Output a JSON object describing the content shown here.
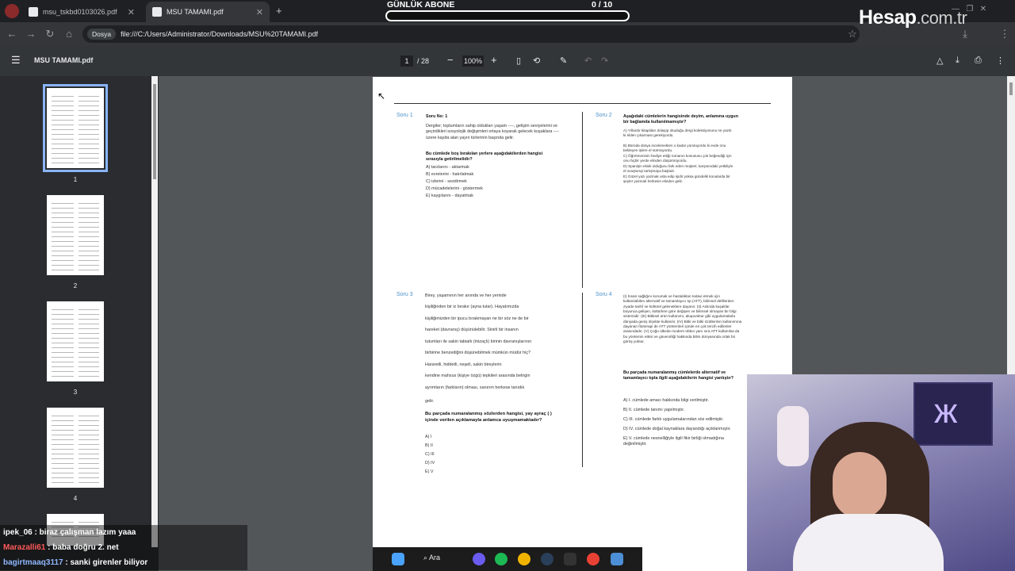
{
  "tabs": [
    {
      "label": "msu_tskbd0103026.pdf",
      "active": false
    },
    {
      "label": "MSU TAMAMI.pdf",
      "active": true
    }
  ],
  "address": {
    "chip": "Dosya",
    "url": "file:///C:/Users/Administrator/Downloads/MSU%20TAMAMI.pdf"
  },
  "pdf_toolbar": {
    "title": "MSU TAMAMI.pdf",
    "page": "1",
    "total": "/ 28",
    "zoom": "100%"
  },
  "thumbnails": [
    "1",
    "2",
    "3",
    "4"
  ],
  "overlay": {
    "label": "GÜNLÜK ABONE",
    "count": "0 / 10",
    "logo": "Hesap",
    "logo_suffix": ".com.tr"
  },
  "pdf_page": {
    "q1": {
      "label": "Soru 1",
      "header": "Soru No: 1",
      "text": "Dergiler; toplumların sahip oldukları yaşam ----, gelişim seviyelerini ve geçirdikleri sosyolojik değişimleri ortaya koyarak gelecek kuşaklara ---- üzere kayda alan yayın türlerinin başında gelir.",
      "question": "Bu cümlede boş bırakılan yerlere aşağıdakilerden hangisi sırasıyla getirilmelidir?",
      "options": [
        "A) tarzlarını - aktarmak",
        "B) evrelerini - hatırlatmak",
        "C) izlerini - sezdirmek",
        "D) mücadelelerini - göstermek",
        "E) kaygılarını - dayatmak"
      ]
    },
    "q2": {
      "label": "Soru 2",
      "question": "Aşağıdaki cümlelerin hangisinde deyim, anlamına uygun bir bağlamda kullanılmamıştır?",
      "options": [
        "A) Yıllardır kitaplıları dolaşıp okuduğu dergi koleksiyonunu ne yazık ki elden çıkarması gerekiyordu.",
        "B) Büroda dosya incelemekten o kadar yoruluyordu ki evde onu bekleyen işlere el sürmüyordu.",
        "C) Öğretmeninin hediye ettiği romanın konusunu çok beğendiği için onu hiçbir yerde elinden düşürmüyordu.",
        "D) Spanişin eksik olduğunu fark eden müşteri, karşısındaki yetkiliyle el ovuşturup tartışmaya başladı.",
        "E) Güzel yazı yazmak usta edip işidir yoksa gündelik konularda bir şeyler yazmak herkesin elinden gelir."
      ]
    },
    "q3": {
      "label": "Soru 3",
      "lines": [
        "Birey, yaşamının her anında ve her yerinde",
        "kişiliğinden bir iz bırakır (ayna tutar). Hayatımızda",
        "kişiliğimizden bir ipucu bırakmayan ne bir söz ne de bir",
        "hareket (davranış) düşünülebilir. Sinirli bir insanın",
        "tutumları ile sakin tabiatlı (mizaçlı) birinin davranışlarının",
        "birbirine benzediğini düşünebilmek mümkün müdür hiç?",
        "Hararetli, hiddetli, neşeli, sakin bireylerin",
        "kendine mahsus (kişiye özgü) tepkileri arasında belirgin",
        "ayrımların (farkların) olması, sanırım herkese tanıdık",
        "gelir."
      ],
      "question": "Bu parçada numaralanmış sözlerden hangisi, yay ayraç ( ) içinde verilen açıklamayla anlamca uyuşmamaktadır?",
      "options": [
        "A) I",
        "B) II",
        "C) III",
        "D) IV",
        "E) V"
      ]
    },
    "q4": {
      "label": "Soru 4",
      "text": "(I) İnsan sağlığını korumak ve hastalıkları tedavi etmek için kullanılabilen alternatif ve tamamlayıcı tıp (ATT), bilimsel delillerden ziyade tarihî ve kültürel geleneklere dayanır. (II) Aslında kuşaklar boyunca gelişen, kültürlere göre değişen ve bilimsel olmayan bir bilgi sistemidir. (III) Bitkisel ürün kullanımı, akupunktur gibi uygulamalarla dünyada geniş ölçekte kullanılır. (IV) Bitki ve bitki özütlerinin kullanımına dayanan fitoterapi de ATT yöntemleri içinde en çok tercih edilenler arasındadır. (V) Çoğu ülkede modern tıbbın yanı sıra ATT kullanılsa da bu yöntemin etkisi ve güvenirliği hakkında bilim dünyasında ortak bir görüş yoktur.",
      "question": "Bu parçada numaralanmış cümlelerde alternatif ve tamamlayıcı tıpla ilgili aşağıdakilerin hangisi yanlıştır?",
      "options": [
        "A) I. cümlede amacı hakkında bilgi verilmiştir.",
        "B) II. cümlede tanımı yapılmıştır.",
        "C) III. cümlede farklı uygulamalarından söz edilmiştir.",
        "D) IV. cümlede doğal kaynaklara dayandığı açıklanmıştır.",
        "E) V. cümlede nesnelliğiyle ilgili fikir birliği olmadığına değinilmiştir."
      ]
    }
  },
  "chat": [
    {
      "user": "ipek_06",
      "text": "biraz çalışman lazım yaaa",
      "color": "#ffffff"
    },
    {
      "user": "Marazalli61",
      "text": "baba doğru 2. net",
      "color": "#ff5a5a"
    },
    {
      "user": "bagirtmaaq3117",
      "text": "sanki girenler biliyor",
      "color": "#8fb8ff"
    }
  ],
  "taskbar": {
    "search": "Ara"
  }
}
